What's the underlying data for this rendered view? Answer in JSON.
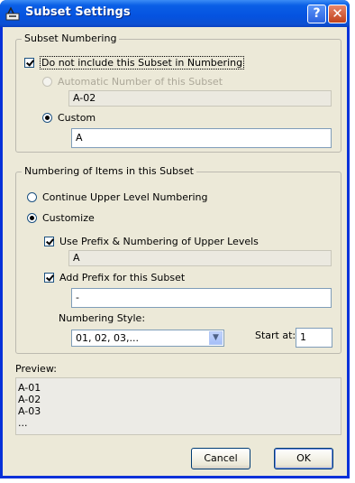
{
  "window": {
    "title": "Subset Settings"
  },
  "subset_numbering": {
    "legend": "Subset Numbering",
    "do_not_include_label": "Do not include this Subset in Numbering",
    "automatic_label": "Automatic Number of this Subset",
    "automatic_value": "A-02",
    "custom_label": "Custom",
    "custom_value": "A"
  },
  "item_numbering": {
    "legend": "Numbering of Items in this Subset",
    "continue_label": "Continue Upper Level Numbering",
    "customize_label": "Customize",
    "use_prefix_label": "Use Prefix & Numbering of Upper Levels",
    "use_prefix_value": "A",
    "add_prefix_label": "Add Prefix for this Subset",
    "add_prefix_value": "-",
    "numbering_style_label": "Numbering Style:",
    "numbering_style_value": "01, 02, 03,...",
    "start_at_label": "Start at:",
    "start_at_value": "1"
  },
  "preview": {
    "label": "Preview:",
    "lines": [
      "A-01",
      "A-02",
      "A-03",
      "..."
    ]
  },
  "buttons": {
    "cancel": "Cancel",
    "ok": "OK"
  },
  "colors": {
    "titlebar": "#0553e0",
    "dialog_bg": "#ece9d8",
    "border": "#0831d9"
  }
}
